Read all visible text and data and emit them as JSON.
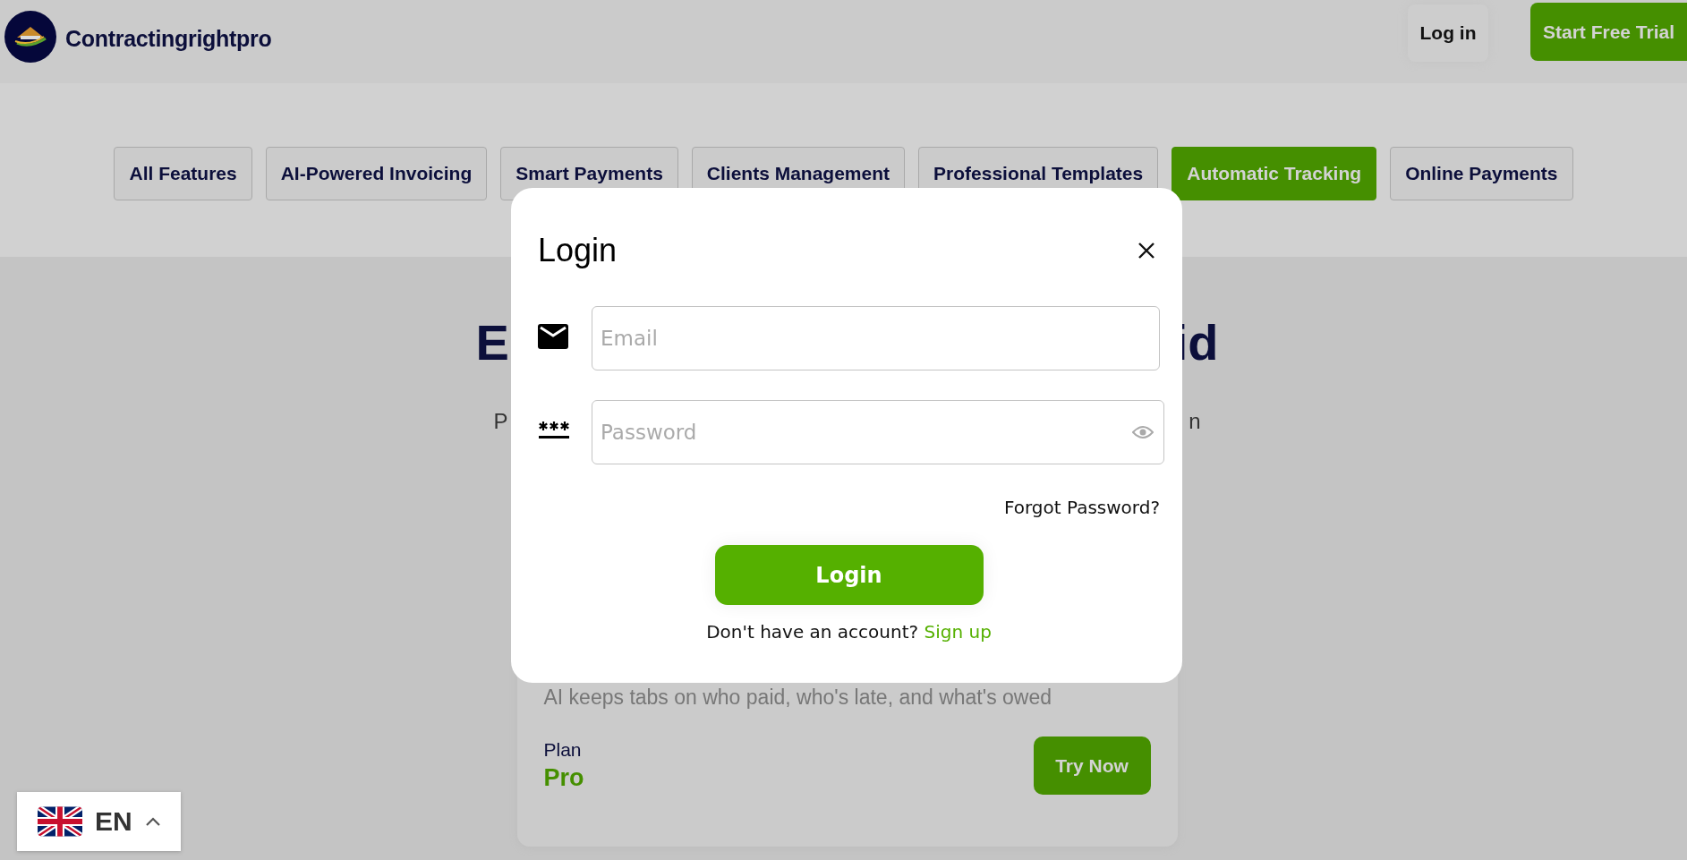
{
  "header": {
    "brand": "Contractingrightpro",
    "login": "Log in",
    "cta": "Start Free Trial"
  },
  "feature_tabs": [
    {
      "label": "All Features",
      "selected": false
    },
    {
      "label": "AI-Powered Invoicing",
      "selected": false
    },
    {
      "label": "Smart Payments",
      "selected": false
    },
    {
      "label": "Clients Management",
      "selected": false
    },
    {
      "label": "Professional Templates",
      "selected": false
    },
    {
      "label": "Automatic Tracking",
      "selected": true
    },
    {
      "label": "Online Payments",
      "selected": false
    }
  ],
  "hero": {
    "heading_left": "E",
    "heading_right": "id",
    "subtitle_left": "P",
    "subtitle_right": "n"
  },
  "plan_card": {
    "description": "AI keeps tabs on who paid, who's late, and what's owed",
    "plan_label": "Plan",
    "plan_name": "Pro",
    "button": "Try Now"
  },
  "login_modal": {
    "title": "Login",
    "email": {
      "placeholder": "Email"
    },
    "password": {
      "placeholder": "Password"
    },
    "forgot": "Forgot Password?",
    "submit": "Login",
    "signup_prompt": "Don't have an account?",
    "signup_link": "Sign up"
  },
  "language": {
    "code": "EN"
  }
}
